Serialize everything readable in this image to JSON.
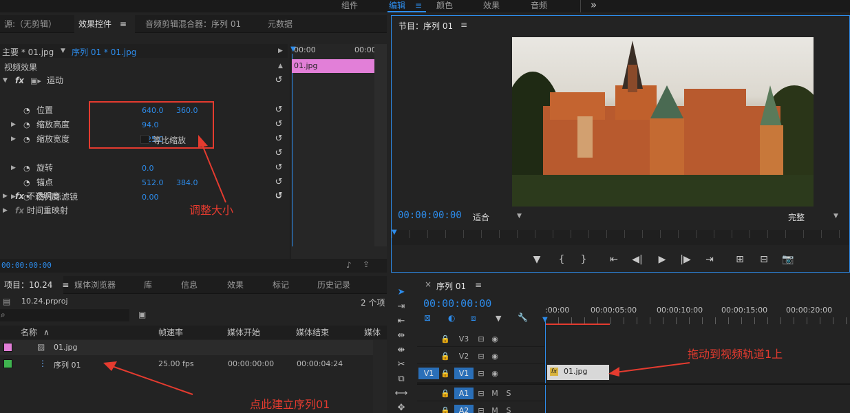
{
  "workspace": {
    "tabs": [
      "组件",
      "编辑",
      "颜色",
      "效果",
      "音频"
    ],
    "active_tab": "编辑",
    "menu_glyph": "≡",
    "more_glyph": "»"
  },
  "effect_controls": {
    "tabs": [
      "源:（无剪辑）",
      "效果控件",
      "音频剪辑混合器：序列 01",
      "元数据"
    ],
    "tab_menu_glyph": "≡",
    "master_label": "主要 * 01.jpg",
    "clip_label": "序列 01 * 01.jpg",
    "section_title": "视频效果",
    "motion_label": "运动",
    "properties": [
      {
        "name": "位置",
        "v1": "640.0",
        "v2": "360.0"
      },
      {
        "name": "缩放高度",
        "v1": "94.0",
        "v2": ""
      },
      {
        "name": "缩放宽度",
        "v1": "125.0",
        "v2": ""
      },
      {
        "name": "",
        "v1": "",
        "v2": ""
      },
      {
        "name": "旋转",
        "v1": "0.0",
        "v2": ""
      },
      {
        "name": "锚点",
        "v1": "512.0",
        "v2": "384.0"
      },
      {
        "name": "防闪烁滤镜",
        "v1": "0.00",
        "v2": ""
      }
    ],
    "uniform_scale_label": "等比缩放",
    "opacity_label": "不透明度",
    "time_remap_label": "时间重映射",
    "fx_label": "fx",
    "timecode": "00:00:00:00",
    "mini_time_start": "00:00",
    "mini_time_end": "00:00",
    "mini_clip_label": "01.jpg",
    "annotation": "调整大小"
  },
  "program": {
    "title": "节目：序列 01",
    "menu_glyph": "≡",
    "timecode": "00:00:00:00",
    "fit_label": "适合",
    "quality_label": "完整",
    "controls": [
      "▼",
      "{",
      "}",
      "⇤",
      "◀|",
      "▶",
      "|▶",
      "⇥",
      "⊞",
      "⊟",
      "📷"
    ]
  },
  "project": {
    "tabs": [
      "项目：10.24",
      "媒体浏览器",
      "库",
      "信息",
      "效果",
      "标记",
      "历史记录"
    ],
    "tab_menu_glyph": "≡",
    "filename": "10.24.prproj",
    "count": "2 个项",
    "columns": [
      "名称",
      "帧速率",
      "媒体开始",
      "媒体结束",
      "媒体持"
    ],
    "items": [
      {
        "name": "01.jpg",
        "color": "#e27fd8",
        "fps": "",
        "start": "",
        "end": ""
      },
      {
        "name": "序列 01",
        "color": "#3fb34f",
        "fps": "25.00 fps",
        "start": "00:00:00:00",
        "end": "00:00:04:24"
      }
    ],
    "annotation": "点此建立序列01"
  },
  "timeline": {
    "title": "序列 01",
    "close_glyph": "×",
    "menu_glyph": "≡",
    "timecode": "00:00:00:00",
    "ruler_labels": [
      ":00:00",
      "00:00:05:00",
      "00:00:10:00",
      "00:00:15:00",
      "00:00:20:00"
    ],
    "video_tracks": [
      {
        "src": "",
        "name": "V3"
      },
      {
        "src": "",
        "name": "V2"
      },
      {
        "src": "V1",
        "name": "V1"
      }
    ],
    "audio_tracks": [
      {
        "name": "A1"
      },
      {
        "name": "A2"
      }
    ],
    "clip_label": "01.jpg",
    "annotation": "拖动到视频轨道1上",
    "colors": {
      "accent": "#2d8ceb",
      "annotation": "#e53b2f",
      "clip_pink": "#e27fd8",
      "clip_gray": "#d8d8d8"
    }
  }
}
